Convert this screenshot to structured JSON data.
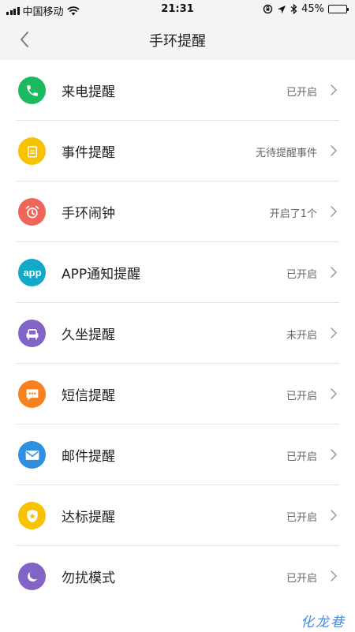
{
  "status_bar": {
    "carrier": "中国移动",
    "time": "21:31",
    "battery": "45%",
    "battery_level": 0.45
  },
  "nav": {
    "title": "手环提醒",
    "back_icon": "chevron-left-icon"
  },
  "items": [
    {
      "label": "来电提醒",
      "status": "已开启",
      "icon": "phone-icon",
      "color": "#1cb95f"
    },
    {
      "label": "事件提醒",
      "status": "无待提醒事件",
      "icon": "memo-icon",
      "color": "#f7c300"
    },
    {
      "label": "手环闹钟",
      "status": "开启了1个",
      "icon": "alarm-clock-icon",
      "color": "#f0655a"
    },
    {
      "label": "APP通知提醒",
      "status": "已开启",
      "icon": "app-icon",
      "color": "#12a9c9"
    },
    {
      "label": "久坐提醒",
      "status": "未开启",
      "icon": "armchair-icon",
      "color": "#8264c6"
    },
    {
      "label": "短信提醒",
      "status": "已开启",
      "icon": "message-icon",
      "color": "#f6811d"
    },
    {
      "label": "邮件提醒",
      "status": "已开启",
      "icon": "mail-icon",
      "color": "#2f8fe0"
    },
    {
      "label": "达标提醒",
      "status": "已开启",
      "icon": "badge-icon",
      "color": "#f7c300"
    },
    {
      "label": "勿扰模式",
      "status": "已开启",
      "icon": "moon-icon",
      "color": "#8264c6"
    }
  ],
  "watermark": "化龙巷"
}
